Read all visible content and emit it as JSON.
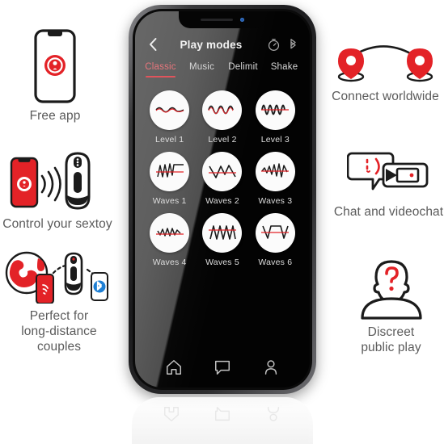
{
  "features": {
    "free_app": {
      "label": "Free app",
      "icon": "phone-lock-icon"
    },
    "control": {
      "label": "Control your sextoy",
      "icon": "phone-signal-toy-icon"
    },
    "long_dist": {
      "label": "Perfect for\nlong-distance\ncouples",
      "icon": "globe-phone-toy-bluetooth-icon"
    },
    "connect": {
      "label": "Connect worldwide",
      "icon": "two-map-pins-icon"
    },
    "chat": {
      "label": "Chat and videochat",
      "icon": "chat-bubble-video-icon"
    },
    "discreet": {
      "label": "Discreet\npublic play",
      "icon": "anonymous-person-icon"
    }
  },
  "phone": {
    "header": {
      "back_label": "‹",
      "title": "Play modes",
      "icons": [
        {
          "name": "timer-icon",
          "label": "Timer"
        },
        {
          "name": "bluetooth-icon",
          "label": "Bluetooth"
        }
      ]
    },
    "tabs": [
      {
        "label": "Classic",
        "active": true
      },
      {
        "label": "Music",
        "active": false
      },
      {
        "label": "Delimit",
        "active": false
      },
      {
        "label": "Shake",
        "active": false
      }
    ],
    "modes": [
      {
        "label": "Level 1",
        "wave": "sine-low"
      },
      {
        "label": "Level 2",
        "wave": "sine-mid"
      },
      {
        "label": "Level 3",
        "wave": "sine-high"
      },
      {
        "label": "Waves 1",
        "wave": "ramp-plateau"
      },
      {
        "label": "Waves 2",
        "wave": "zigzag-wide"
      },
      {
        "label": "Waves 3",
        "wave": "zigzag-rising"
      },
      {
        "label": "Waves 4",
        "wave": "zigzag-small"
      },
      {
        "label": "Waves 5",
        "wave": "sawtooth"
      },
      {
        "label": "Waves 6",
        "wave": "v-plateau-v"
      }
    ],
    "nav": [
      {
        "name": "home-icon",
        "label": "Home"
      },
      {
        "name": "chat-icon",
        "label": "Chat"
      },
      {
        "name": "profile-icon",
        "label": "Profile"
      }
    ]
  },
  "colors": {
    "accent_red": "#E32227",
    "tab_active": "#E8767C",
    "caption_gray": "#5B5B5B",
    "bluetooth_blue": "#1E7FD4"
  }
}
